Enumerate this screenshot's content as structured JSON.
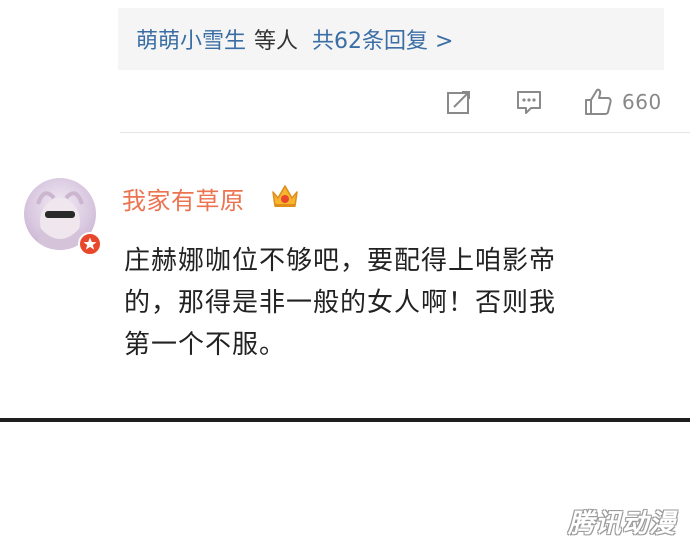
{
  "reply_preview": {
    "users": "萌萌小雪生",
    "etc": "等人",
    "total": "共62条回复 >"
  },
  "actions": {
    "share_icon": "share-edit-icon",
    "comment_icon": "comment-icon",
    "like_icon": "thumbs-up-icon",
    "like_count": "660"
  },
  "comment": {
    "username": "我家有草原",
    "avatar_badge_icon": "verified-badge-icon",
    "crown_icon": "crown-badge-icon",
    "text_lines": [
      "庄赫娜咖位不够吧，要配得上咱影帝",
      "的，那得是非一般的女人啊！否则我",
      "第一个不服。"
    ]
  },
  "watermark": "腾讯动漫",
  "colors": {
    "link_blue": "#3a6ea5",
    "username_orange": "#eb7350",
    "text_dark": "#222222",
    "muted_gray": "#888888",
    "reply_bg": "#f5f5f5",
    "rule_dark": "#1e1e1e"
  }
}
